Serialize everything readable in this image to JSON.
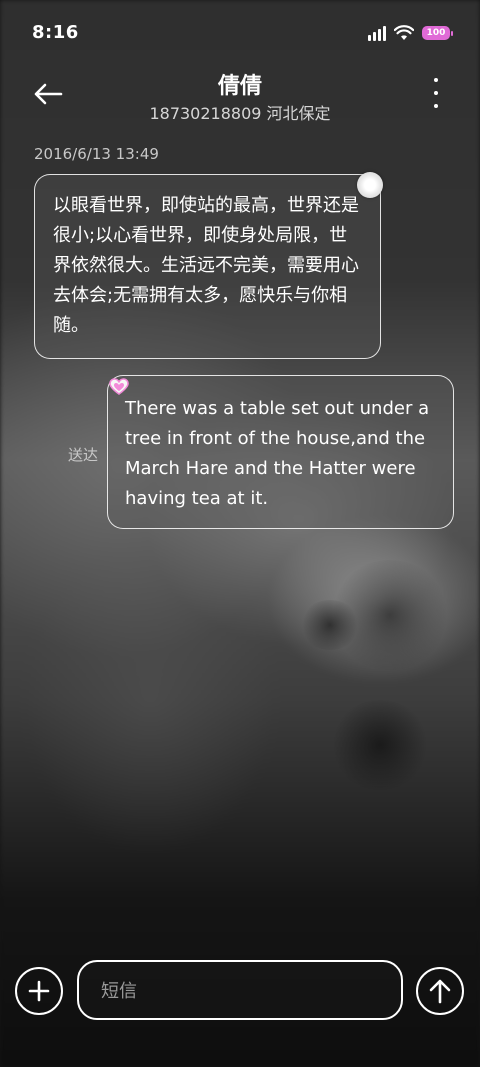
{
  "status_bar": {
    "time": "8:16",
    "battery": "100",
    "icons": [
      "signal-icon",
      "wifi-icon",
      "battery-icon"
    ]
  },
  "header": {
    "back_icon": "arrow-left-icon",
    "title": "倩倩",
    "subtitle": "18730218809 河北保定",
    "more_icon": "more-vertical-icon"
  },
  "conversation": {
    "timestamp": "2016/6/13 13:49",
    "messages": [
      {
        "direction": "incoming",
        "text": "以眼看世界，即使站的最高，世界还是很小;以心看世界，即使身处局限，世界依然很大。生活远不完美，需要用心去体会;无需拥有太多，愿快乐与你相随。",
        "decoration_icon": "flower-icon"
      },
      {
        "direction": "outgoing",
        "text": "There was a table set out under a tree in front of the house,and the March Hare and the Hatter were having tea at it.",
        "status": "送达",
        "decoration_icon": "heart-icon"
      }
    ]
  },
  "composer": {
    "add_icon": "plus-icon",
    "placeholder": "短信",
    "send_icon": "send-arrow-up-icon"
  },
  "colors": {
    "battery_accent": "#e06ad6",
    "bubble_border": "#ffffff",
    "heart": "#f28ad8"
  }
}
